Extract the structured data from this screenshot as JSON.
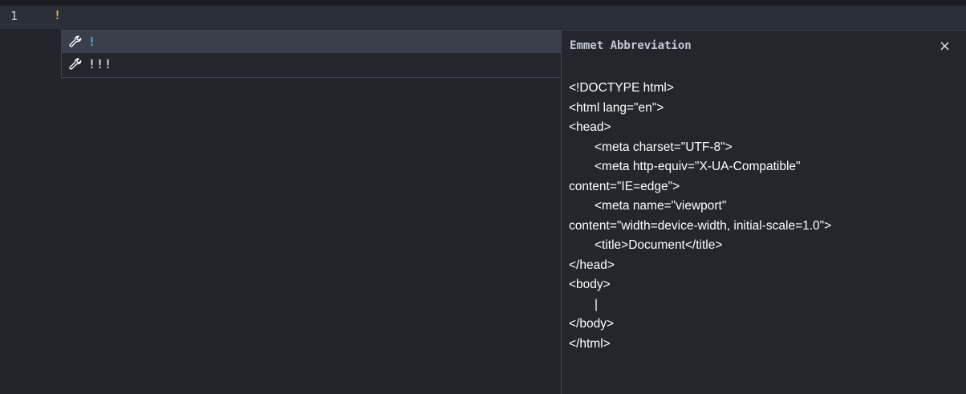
{
  "editor": {
    "line_number": "1",
    "line_text": "!"
  },
  "suggest": {
    "items": [
      {
        "label": "!",
        "icon": "wrench-icon",
        "selected": true
      },
      {
        "label": "!!!",
        "icon": "wrench-icon",
        "selected": false
      }
    ]
  },
  "details": {
    "title": "Emmet Abbreviation",
    "close_label": "×",
    "lines": [
      "<!DOCTYPE html>",
      "<html lang=\"en\">",
      "<head>",
      "<meta charset=\"UTF-8\">",
      "<meta http-equiv=\"X-UA-Compatible\"",
      "content=\"IE=edge\">",
      "<meta name=\"viewport\"",
      "content=\"width=device-width, initial-scale=1.0\">",
      "<title>Document</title>",
      "</head>",
      "<body>",
      "|",
      "</body>",
      "</html>"
    ]
  },
  "colors": {
    "background": "#22252b",
    "selected_item": "#3b3f4b",
    "accent_label": "#48b8e0",
    "cursor_text": "#d7b15a"
  }
}
